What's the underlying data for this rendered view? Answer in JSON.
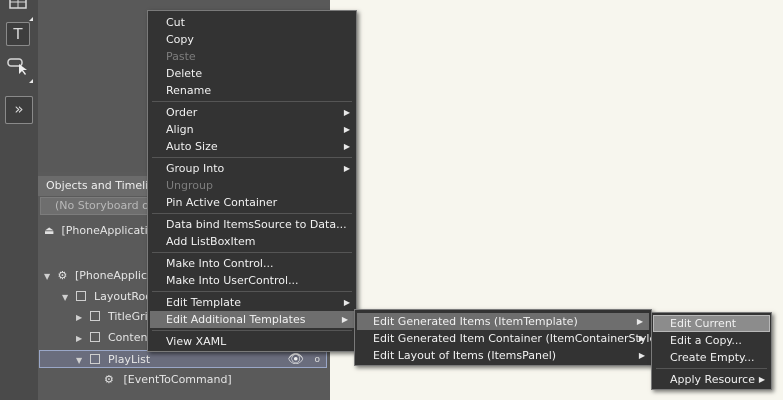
{
  "toolstrip": {
    "icons": [
      "grid-tool-icon",
      "text-tool-icon",
      "selection-tool-icon",
      "expand-icon"
    ],
    "text_tool_glyph": "T",
    "expand_glyph": "»"
  },
  "objects_panel": {
    "header": "Objects and Timelin",
    "storyboard": "(No Storyboard op",
    "tree": [
      {
        "label": "[PhoneApplicatio",
        "arrow": "",
        "icon": "phone-page-icon"
      },
      {
        "label": "[PhoneApplicat",
        "arrow": "▼",
        "icon": "phone-app-icon"
      },
      {
        "label": "LayoutRoot",
        "arrow": "▼",
        "icon": "grid-node-icon"
      },
      {
        "label": "TitleGrid",
        "arrow": "▶",
        "icon": "grid-node-icon"
      },
      {
        "label": "Content",
        "arrow": "▶",
        "icon": "grid-node-icon"
      },
      {
        "label": "PlayList",
        "arrow": "▼",
        "icon": "listbox-node-icon"
      },
      {
        "label": "[EventToCommand]",
        "arrow": "",
        "icon": "behavior-icon"
      }
    ],
    "eye_glyph": "👁",
    "lock_glyph": "o"
  },
  "context_menu": {
    "items": [
      {
        "label": "Cut"
      },
      {
        "label": "Copy"
      },
      {
        "label": "Paste"
      },
      {
        "label": "Delete"
      },
      {
        "label": "Rename"
      },
      {
        "label": "Order"
      },
      {
        "label": "Align"
      },
      {
        "label": "Auto Size"
      },
      {
        "label": "Group Into"
      },
      {
        "label": "Ungroup"
      },
      {
        "label": "Pin Active Container"
      },
      {
        "label": "Data bind ItemsSource to Data..."
      },
      {
        "label": "Add ListBoxItem"
      },
      {
        "label": "Make Into Control..."
      },
      {
        "label": "Make Into UserControl..."
      },
      {
        "label": "Edit Template"
      },
      {
        "label": "Edit Additional Templates"
      },
      {
        "label": "View XAML"
      }
    ],
    "submenu_arrow": "▶"
  },
  "additional_templates_menu": {
    "items": [
      {
        "label": "Edit Generated Items (ItemTemplate)"
      },
      {
        "label": "Edit Generated Item Container (ItemContainerStyle)"
      },
      {
        "label": "Edit Layout of Items (ItemsPanel)"
      }
    ]
  },
  "item_template_menu": {
    "items": [
      {
        "label": "Edit Current"
      },
      {
        "label": "Edit a Copy..."
      },
      {
        "label": "Create Empty..."
      },
      {
        "label": "Apply Resource"
      }
    ]
  }
}
